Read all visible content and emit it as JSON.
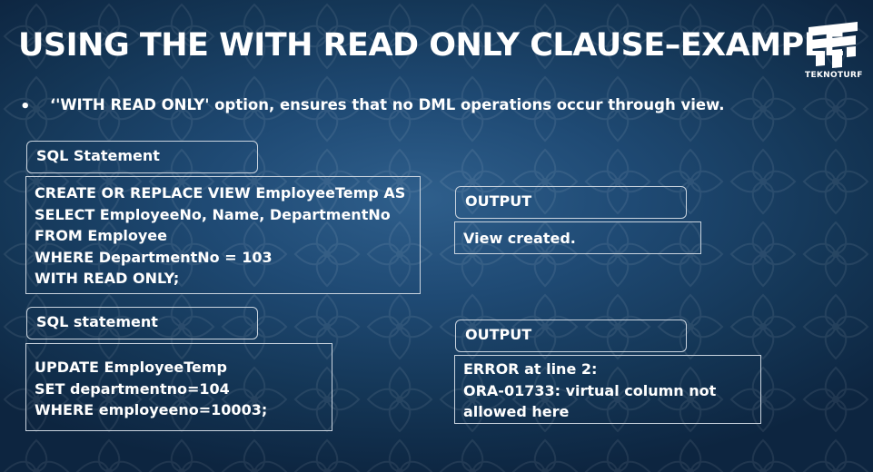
{
  "slide": {
    "title": "USING THE WITH READ ONLY CLAUSE–EXAMPLE",
    "bullet": "‘'WITH READ ONLY' option, ensures that no DML operations occur through view."
  },
  "logo": {
    "text": "TEKNOTURF"
  },
  "example1": {
    "label": "SQL Statement",
    "code": [
      "CREATE OR REPLACE VIEW EmployeeTemp AS",
      "SELECT EmployeeNo, Name, DepartmentNo",
      "FROM Employee",
      "WHERE DepartmentNo = 103",
      "WITH READ ONLY;"
    ],
    "output_label": "OUTPUT",
    "output": [
      "View created."
    ]
  },
  "example2": {
    "label": "SQL statement",
    "code": [
      "UPDATE EmployeeTemp",
      "SET departmentno=104",
      "WHERE employeeno=10003;"
    ],
    "output_label": "OUTPUT",
    "output": [
      "ERROR at line 2:",
      "ORA-01733: virtual column not",
      "allowed here"
    ]
  }
}
